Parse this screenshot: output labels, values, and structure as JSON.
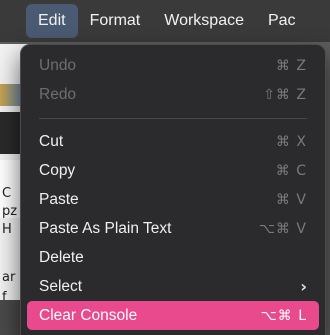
{
  "menubar": {
    "items": [
      "Edit",
      "Format",
      "Workspace",
      "Pac"
    ],
    "active_index": 0
  },
  "edit_menu": {
    "group1": [
      {
        "label": "Undo",
        "shortcut": "⌘ Z",
        "enabled": false
      },
      {
        "label": "Redo",
        "shortcut": "⇧⌘ Z",
        "enabled": false
      }
    ],
    "group2": [
      {
        "label": "Cut",
        "shortcut": "⌘ X",
        "enabled": true
      },
      {
        "label": "Copy",
        "shortcut": "⌘ C",
        "enabled": true
      },
      {
        "label": "Paste",
        "shortcut": "⌘ V",
        "enabled": true
      },
      {
        "label": "Paste As Plain Text",
        "shortcut": "⌥⌘ V",
        "enabled": true
      },
      {
        "label": "Delete",
        "shortcut": "",
        "enabled": true
      },
      {
        "label": "Select",
        "submenu_icon": "chevron-right-icon",
        "enabled": true
      },
      {
        "label": "Clear Console",
        "shortcut": "⌥⌘ L",
        "enabled": true,
        "highlighted": true
      }
    ],
    "highlight_color": "#e94a8e"
  },
  "background": {
    "fragments": [
      "C",
      "pz",
      "H",
      "ar",
      "f"
    ]
  }
}
